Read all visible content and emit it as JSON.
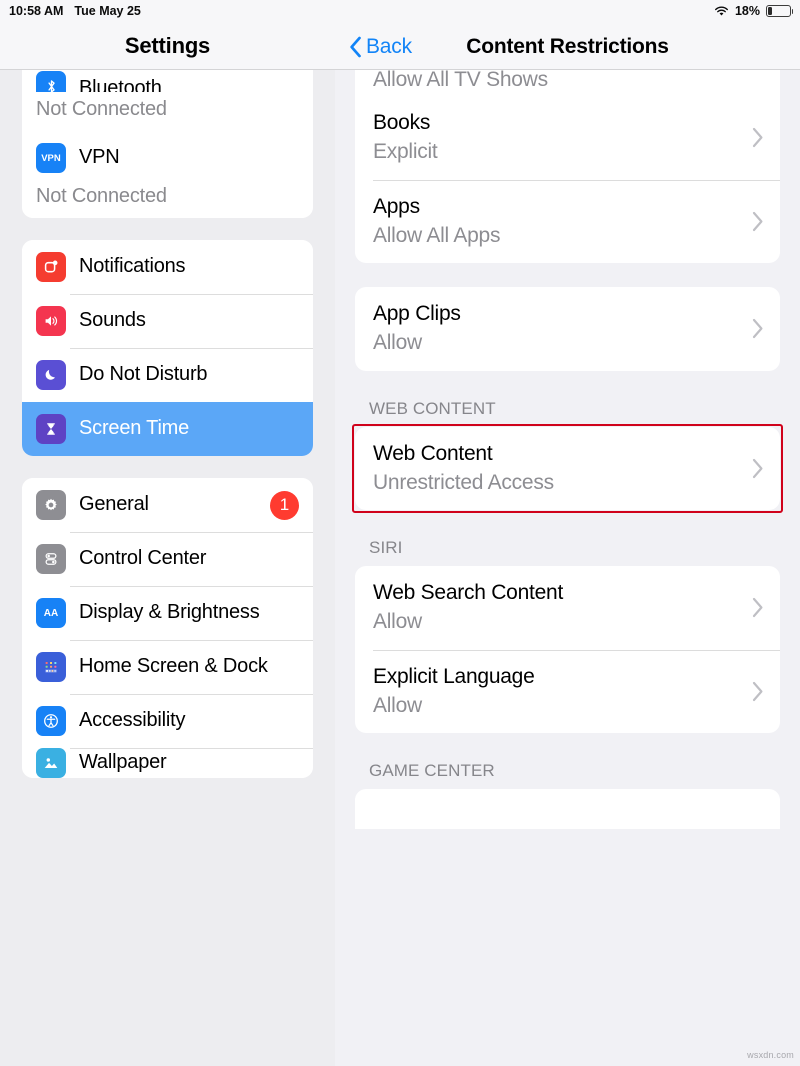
{
  "status_bar": {
    "time": "10:58 AM",
    "date": "Tue May 25",
    "battery_percent": "18%",
    "battery_level": 18,
    "wifi_icon": "wifi-icon",
    "battery_icon": "battery-icon"
  },
  "sidebar": {
    "title": "Settings",
    "groups": [
      {
        "clipped_top": true,
        "items": [
          {
            "label": "Bluetooth",
            "sub": "Not Connected",
            "icon": "bluetooth-icon",
            "icon_color": "#1782f6",
            "clipped": true
          },
          {
            "label": "VPN",
            "sub": "Not Connected",
            "icon": "vpn-icon",
            "icon_color": "#1782f6",
            "icon_text": "VPN"
          }
        ]
      },
      {
        "items": [
          {
            "label": "Notifications",
            "icon": "notifications-icon",
            "icon_color": "#f53c30"
          },
          {
            "label": "Sounds",
            "icon": "sounds-icon",
            "icon_color": "#f4354f"
          },
          {
            "label": "Do Not Disturb",
            "icon": "do-not-disturb-icon",
            "icon_color": "#5a4fd4"
          },
          {
            "label": "Screen Time",
            "icon": "screen-time-icon",
            "icon_color": "#5e42c4",
            "selected": true
          }
        ]
      },
      {
        "items": [
          {
            "label": "General",
            "icon": "general-gear-icon",
            "icon_color": "#8e8e93",
            "badge": "1"
          },
          {
            "label": "Control Center",
            "icon": "control-center-icon",
            "icon_color": "#8e8e93"
          },
          {
            "label": "Display & Brightness",
            "icon": "display-brightness-icon",
            "icon_color": "#1782f6",
            "icon_text": "AA"
          },
          {
            "label": "Home Screen & Dock",
            "icon": "home-screen-dock-icon",
            "icon_color": "#3a5fd9"
          },
          {
            "label": "Accessibility",
            "icon": "accessibility-icon",
            "icon_color": "#1782f6"
          },
          {
            "label": "Wallpaper",
            "icon": "wallpaper-icon",
            "icon_color": "#3ab0e2",
            "clipped_bottom": true
          }
        ]
      }
    ],
    "selected_accent": "#5ba7f7",
    "badge_color": "#ff3b30"
  },
  "main": {
    "back_label": "Back",
    "back_icon": "chevron-left-icon",
    "title": "Content Restrictions",
    "clipped_top_row": {
      "value": "Allow All TV Shows"
    },
    "sections": [
      {
        "header": "",
        "rows": [
          {
            "title": "Books",
            "value": "Explicit",
            "chevron": "chevron-right-icon"
          },
          {
            "title": "Apps",
            "value": "Allow All Apps",
            "chevron": "chevron-right-icon"
          }
        ]
      },
      {
        "header": "",
        "rows": [
          {
            "title": "App Clips",
            "value": "Allow",
            "chevron": "chevron-right-icon"
          }
        ]
      },
      {
        "header": "WEB CONTENT",
        "rows": [
          {
            "title": "Web Content",
            "value": "Unrestricted Access",
            "chevron": "chevron-right-icon",
            "highlighted": true
          }
        ]
      },
      {
        "header": "SIRI",
        "rows": [
          {
            "title": "Web Search Content",
            "value": "Allow",
            "chevron": "chevron-right-icon"
          },
          {
            "title": "Explicit Language",
            "value": "Allow",
            "chevron": "chevron-right-icon"
          }
        ]
      },
      {
        "header": "GAME CENTER",
        "rows": []
      }
    ],
    "highlight_color": "#d0021b"
  },
  "watermark": "wsxdn.com"
}
